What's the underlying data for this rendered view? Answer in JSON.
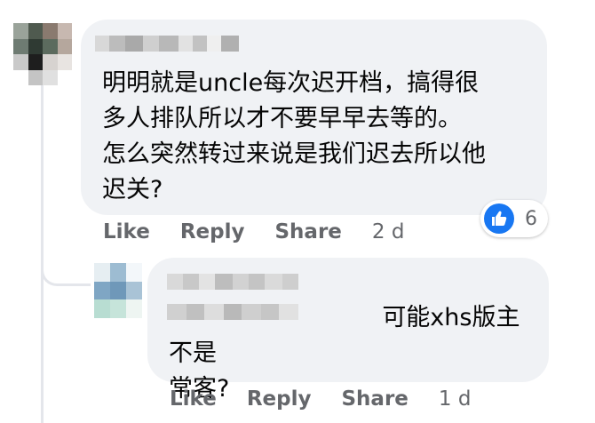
{
  "comments": [
    {
      "text": "明明就是uncle每次迟开档，搞得很\n多人排队所以才不要早早去等的。\n怎么突然转过来说是我们迟去所以他\n迟关?",
      "actions": {
        "like": "Like",
        "reply": "Reply",
        "share": "Share",
        "age": "2 d"
      },
      "reactions": {
        "icon": "thumbs-up-icon",
        "count": "6",
        "color": "#1877f2"
      }
    },
    {
      "text": "                            可能xhs版主不是\n常客?",
      "actions": {
        "like": "Like",
        "reply": "Reply",
        "share": "Share",
        "age": "1 d"
      }
    }
  ],
  "colors": {
    "bubble": "#f0f2f5",
    "text": "#050505",
    "meta": "#65676b",
    "thread_line": "#e4e6eb"
  }
}
